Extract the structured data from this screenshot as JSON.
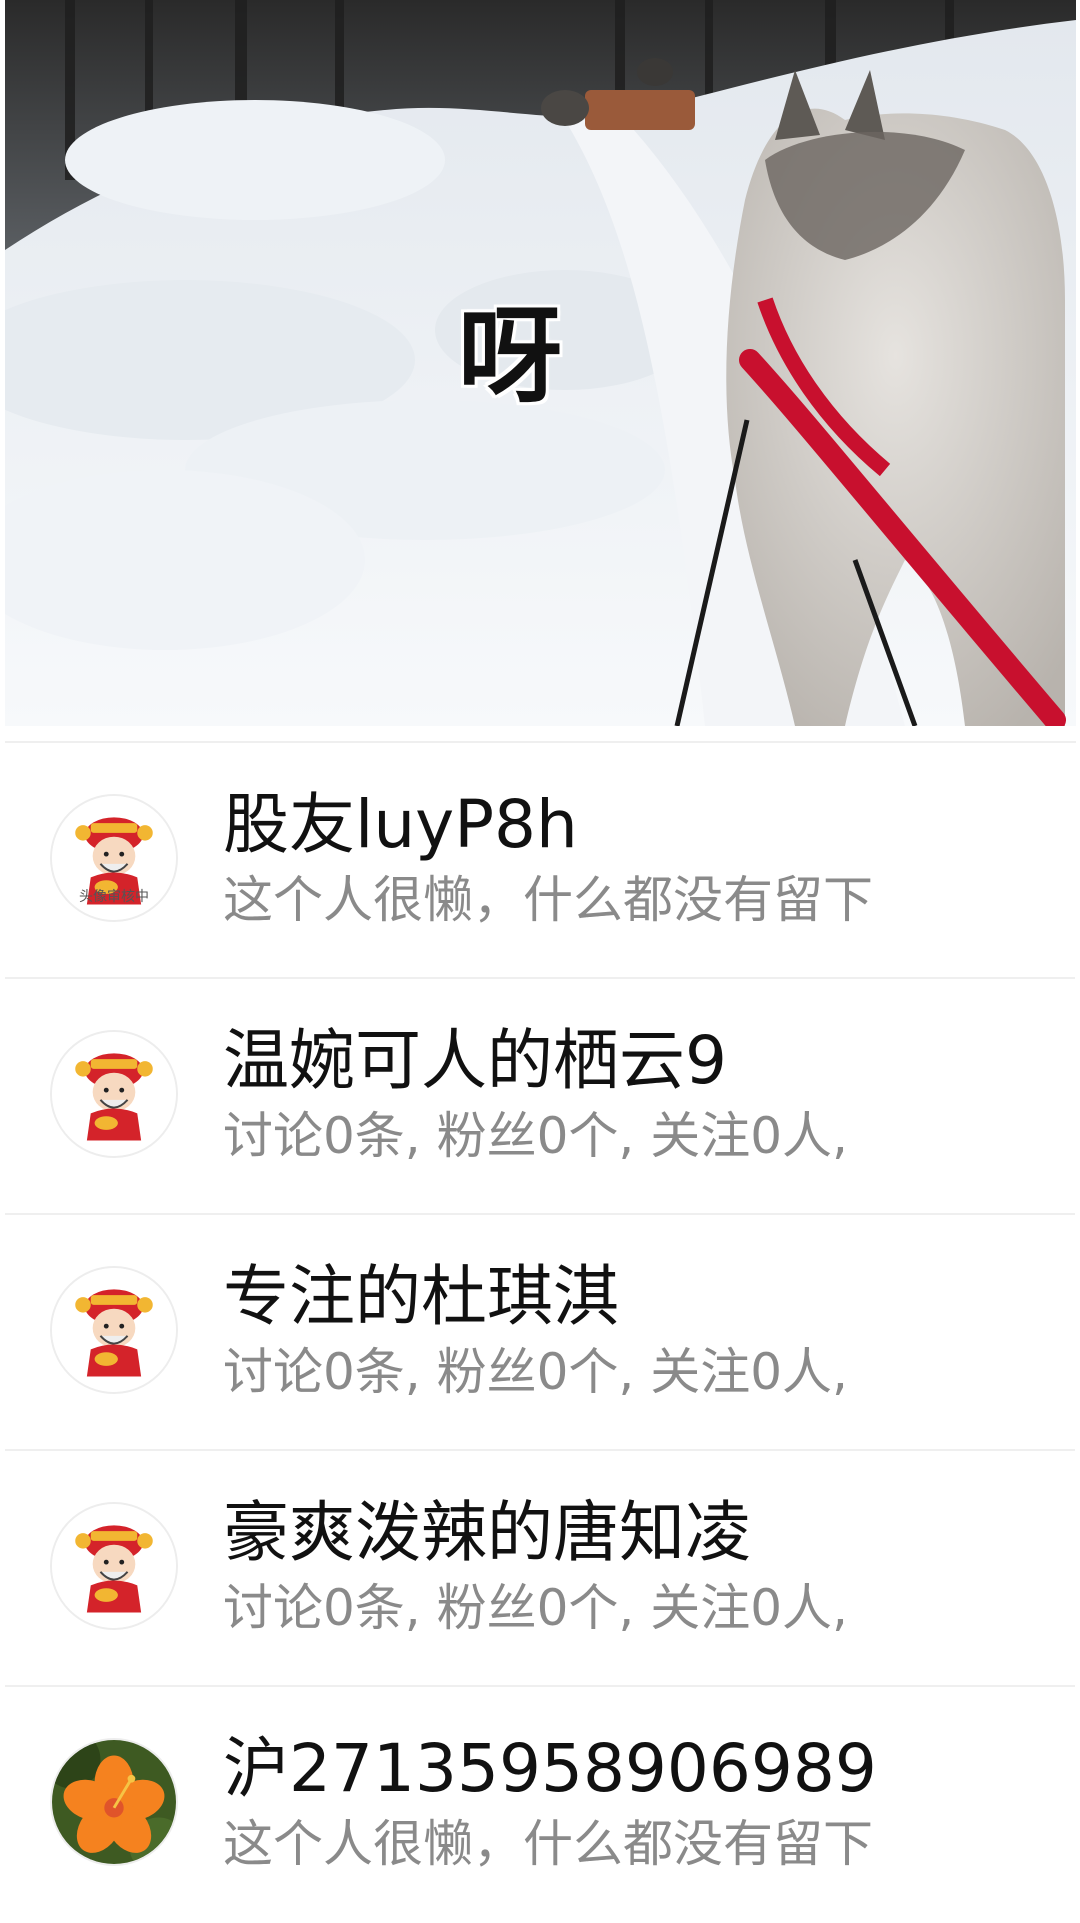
{
  "video": {
    "caption": "呀",
    "scene": "dog-sled-snow-trail"
  },
  "users": [
    {
      "name": "股友luyP8h",
      "description": "这个人很懒，什么都没有留下",
      "avatar": "caishen-cartoon-icon",
      "avatar_tag": "头像审核中"
    },
    {
      "name": "温婉可人的栖云9",
      "description": "讨论0条, 粉丝0个, 关注0人,",
      "avatar": "caishen-cartoon-icon"
    },
    {
      "name": "专注的杜琪淇",
      "description": "讨论0条, 粉丝0个, 关注0人,",
      "avatar": "caishen-cartoon-icon"
    },
    {
      "name": "豪爽泼辣的唐知凌",
      "description": "讨论0条, 粉丝0个, 关注0人,",
      "avatar": "caishen-cartoon-icon"
    },
    {
      "name": "沪27135958906989",
      "description": "这个人很懒，什么都没有留下",
      "avatar": "orange-flower-photo"
    }
  ],
  "colors": {
    "name_text": "#111111",
    "desc_text": "#8a8a8a",
    "divider": "#efefef",
    "harness_red": "#c8102e"
  }
}
